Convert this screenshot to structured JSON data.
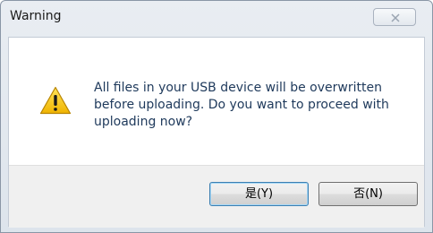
{
  "window": {
    "title": "Warning",
    "close_icon": "close-x-icon"
  },
  "dialog": {
    "icon": "warning-triangle-icon",
    "message": "All files in your USB device will be overwritten before uploading. Do you want to proceed with uploading now?"
  },
  "buttons": {
    "yes_label": "是(Y)",
    "no_label": "否(N)"
  },
  "colors": {
    "message_text": "#1e395b",
    "warning_yellow": "#f5c400",
    "footer_bg": "#f0f0f0"
  }
}
